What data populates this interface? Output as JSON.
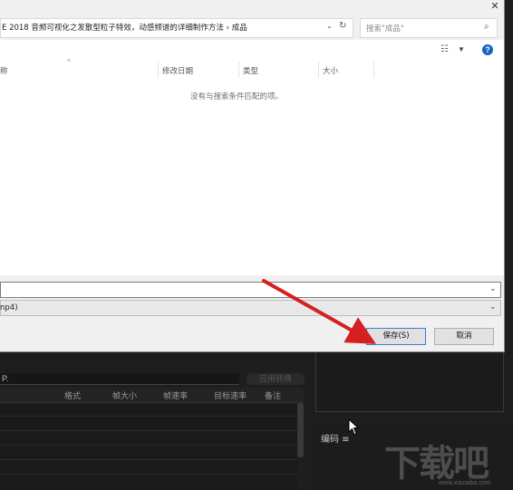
{
  "dialog": {
    "close_glyph": "✕",
    "address_path": "E 2018 音频可视化之发散型粒子特效，动感频谱的详细制作方法  ›  成品",
    "search_placeholder": "搜索\"成品\"",
    "columns": {
      "name": "称",
      "modified": "修改日期",
      "type": "类型",
      "size": "大小"
    },
    "empty_message": "没有与搜索条件匹配的项。",
    "file_type_value": "np4)",
    "save_label": "保存(S)",
    "cancel_label": "取消"
  },
  "queue": {
    "filter_value": "P.",
    "apply_label": "应用转换",
    "columns": [
      "格式",
      "帧大小",
      "帧速率",
      "目标速率",
      "备注"
    ]
  },
  "encode_panel": {
    "label": "编码  ≡"
  },
  "watermark": {
    "text": "下载吧",
    "url": "www.xiazaiba.com"
  },
  "colors": {
    "accent": "#1565c0",
    "arrow": "#d42020",
    "dark_bg": "#1e1e1e",
    "dialog_bg": "#f0f0f0"
  }
}
